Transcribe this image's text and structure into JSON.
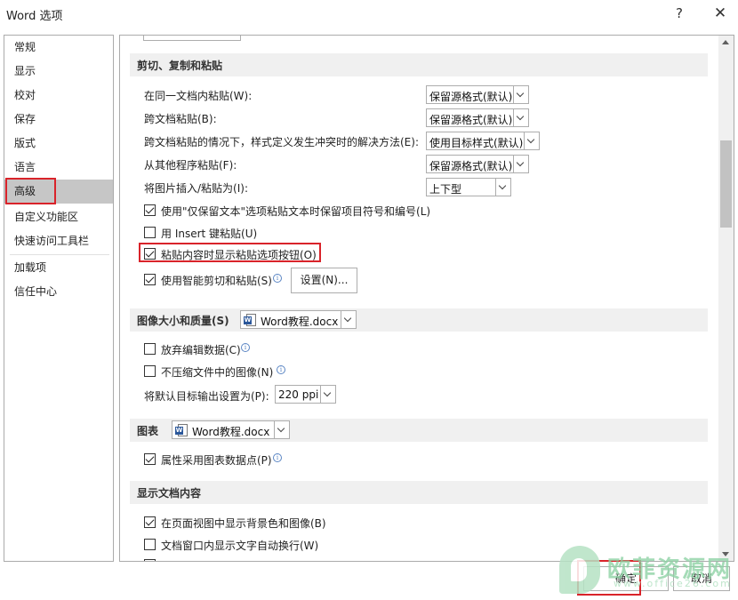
{
  "window": {
    "title": "Word 选项",
    "help_icon": "?",
    "close_icon": "✕"
  },
  "sidebar": {
    "items": [
      {
        "label": "常规"
      },
      {
        "label": "显示"
      },
      {
        "label": "校对"
      },
      {
        "label": "保存"
      },
      {
        "label": "版式"
      },
      {
        "label": "语言"
      },
      {
        "label": "高级",
        "active": true
      },
      {
        "label": "自定义功能区"
      },
      {
        "label": "快速访问工具栏"
      },
      {
        "label": "加载项"
      },
      {
        "label": "信任中心"
      }
    ]
  },
  "sections": {
    "paste": {
      "header": "剪切、复制和粘贴",
      "same_doc_label": "在同一文档内粘贴(W):",
      "same_doc_value": "保留源格式(默认)",
      "cross_doc_label": "跨文档粘贴(B):",
      "cross_doc_value": "保留源格式(默认)",
      "conflict_label": "跨文档粘贴的情况下，样式定义发生冲突时的解决方法(E):",
      "conflict_value": "使用目标样式(默认)",
      "other_prog_label": "从其他程序粘贴(F):",
      "other_prog_value": "保留源格式(默认)",
      "insert_pic_label": "将图片插入/粘贴为(I):",
      "insert_pic_value": "上下型",
      "keep_bullets_label": "使用\"仅保留文本\"选项粘贴文本时保留项目符号和编号(L)",
      "keep_bullets_checked": true,
      "insert_key_label": "用 Insert 键粘贴(U)",
      "insert_key_checked": false,
      "show_paste_btn_label": "粘贴内容时显示粘贴选项按钮(O)",
      "show_paste_btn_checked": true,
      "smart_cut_label": "使用智能剪切和粘贴(S)",
      "smart_cut_checked": true,
      "settings_button": "设置(N)..."
    },
    "image": {
      "header": "图像大小和质量(S)",
      "doc_value": "Word教程.docx",
      "discard_label": "放弃编辑数据(C)",
      "discard_checked": false,
      "no_compress_label": "不压缩文件中的图像(N)",
      "no_compress_checked": false,
      "default_output_label": "将默认目标输出设置为(P):",
      "default_output_value": "220 ppi"
    },
    "chart": {
      "header": "图表",
      "doc_value": "Word教程.docx",
      "props_label": "属性采用图表数据点(P)",
      "props_checked": true
    },
    "display": {
      "header": "显示文档内容",
      "bg_label": "在页面视图中显示背景色和图像(B)",
      "bg_checked": true,
      "wrap_label": "文档窗口内显示文字自动换行(W)",
      "wrap_checked": false
    }
  },
  "footer": {
    "ok": "确定",
    "cancel": "取消"
  },
  "watermark": {
    "text": "欧菲资源网",
    "url": "www.office26.com"
  },
  "colors": {
    "highlight": "#d9232a",
    "active_nav": "#c6c6c6",
    "section_bg": "#f0f0f0"
  }
}
